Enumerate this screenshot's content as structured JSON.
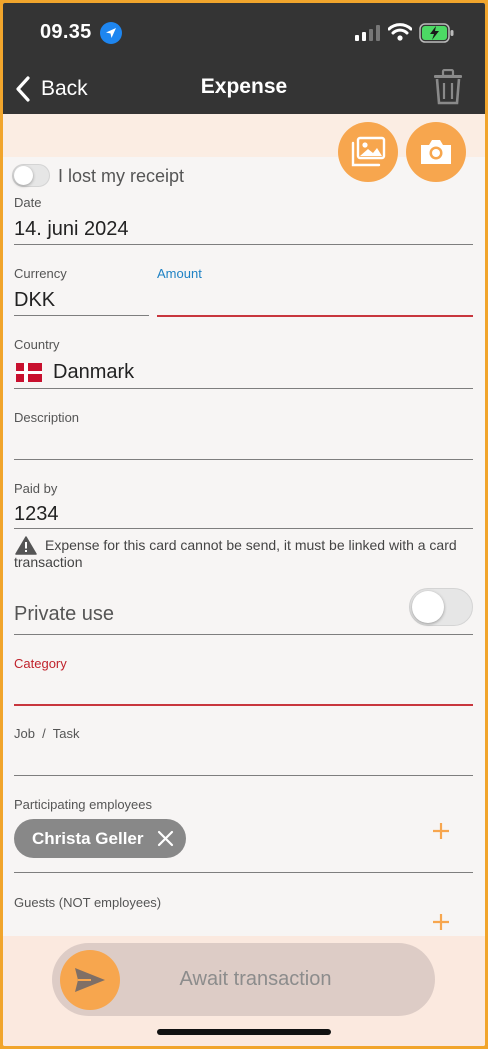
{
  "status_bar": {
    "time": "09.35"
  },
  "nav": {
    "back_label": "Back",
    "title": "Expense"
  },
  "receipt": {
    "lost_label": "I lost my receipt"
  },
  "fields": {
    "date": {
      "label": "Date",
      "value": "14. juni 2024"
    },
    "currency": {
      "label": "Currency",
      "value": "DKK"
    },
    "amount": {
      "label": "Amount",
      "value": ""
    },
    "country": {
      "label": "Country",
      "value": "Danmark"
    },
    "description": {
      "label": "Description",
      "value": ""
    },
    "paid_by": {
      "label": "Paid by",
      "value": "1234"
    },
    "private_use": {
      "label": "Private use"
    },
    "category": {
      "label": "Category",
      "value": ""
    },
    "job_task": {
      "label": "Job  /  Task",
      "value": ""
    },
    "participants": {
      "label": "Participating employees",
      "chips": [
        "Christa Geller"
      ]
    },
    "guests": {
      "label": "Guests (NOT employees)"
    }
  },
  "warning": {
    "text": "Expense for this card cannot be send, it must be linked with a card transaction"
  },
  "footer": {
    "send_label": "Await transaction"
  },
  "colors": {
    "accent_orange": "#f7a64e",
    "header_bg": "#343434",
    "error_red": "#c0232c",
    "link_blue": "#1f82c4"
  },
  "icons": [
    "location-icon",
    "signal-icon",
    "wifi-icon",
    "battery-icon",
    "back-chevron-icon",
    "trash-icon",
    "gallery-icon",
    "camera-icon",
    "warning-icon",
    "close-icon",
    "plus-icon",
    "send-icon",
    "denmark-flag-icon"
  ]
}
